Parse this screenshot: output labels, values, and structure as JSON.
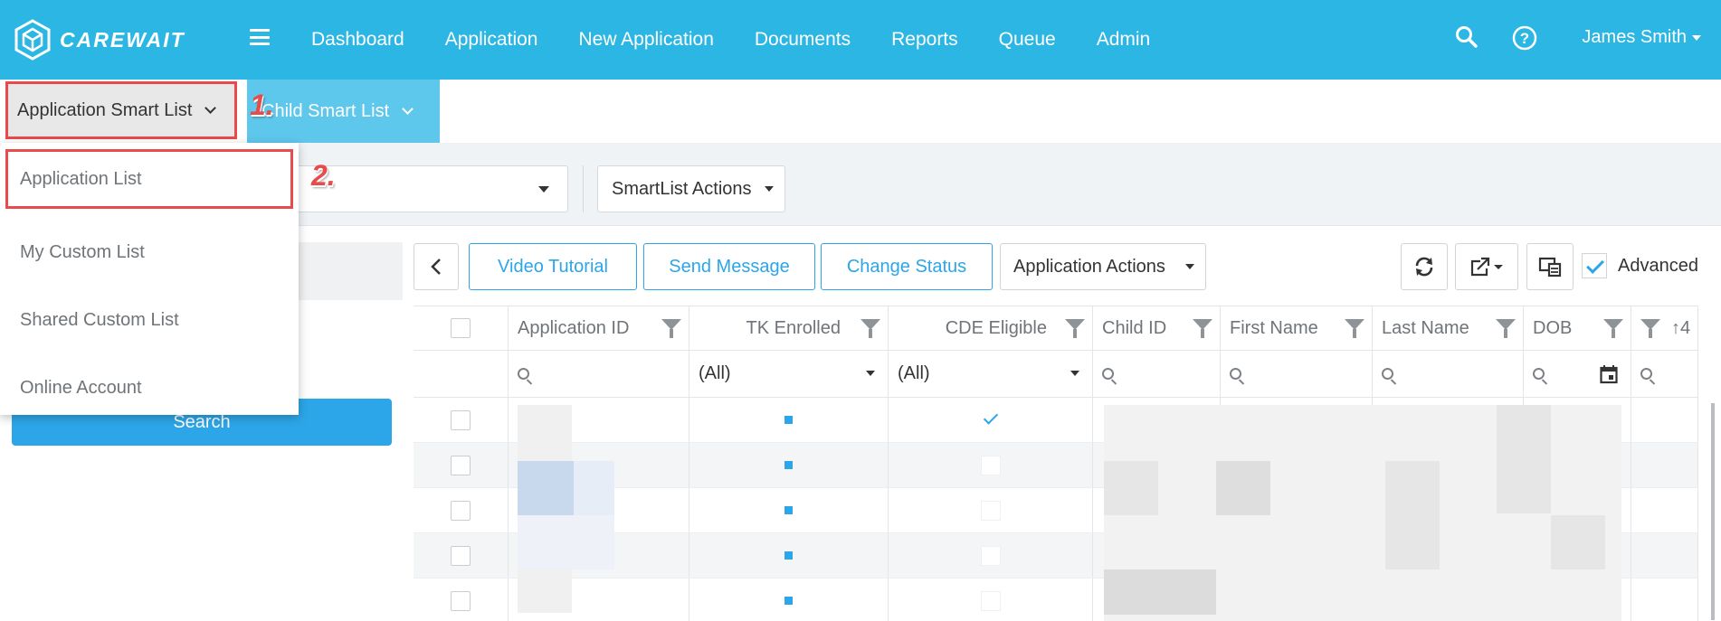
{
  "app": {
    "logo_text": "CAREWAIT"
  },
  "nav": {
    "items": [
      "Dashboard",
      "Application",
      "New Application",
      "Documents",
      "Reports",
      "Queue",
      "Admin"
    ],
    "user": "James Smith"
  },
  "subtabs": {
    "application": "Application Smart List",
    "child": "Child Smart List"
  },
  "annotations": {
    "step1": "1.",
    "step2": "2."
  },
  "dropdown_menu": {
    "items": [
      "Application List",
      "My Custom List",
      "Shared Custom List",
      "Online Account"
    ]
  },
  "filterbar": {
    "smartlist_actions": "SmartList Actions"
  },
  "left_panel": {
    "search_button": "Search"
  },
  "toolbar": {
    "video_tutorial": "Video Tutorial",
    "send_message": "Send Message",
    "change_status": "Change Status",
    "application_actions": "Application Actions",
    "advanced": "Advanced",
    "advanced_checked": true
  },
  "grid": {
    "headers": [
      "Application ID",
      "TK Enrolled",
      "CDE Eligible",
      "Child ID",
      "First Name",
      "Last Name",
      "DOB",
      "↑4"
    ],
    "filters": {
      "tk_enrolled": "(All)",
      "cde_eligible": "(All)"
    },
    "rows": [
      {
        "tk": true,
        "cde": true
      },
      {
        "tk": true,
        "cde": false
      },
      {
        "tk": true,
        "cde": false
      },
      {
        "tk": true,
        "cde": false
      },
      {
        "tk": true,
        "cde": false
      }
    ]
  },
  "colors": {
    "header_bg": "#2cb6e4",
    "accent": "#2ca6e8",
    "annotation": "#e84b4b",
    "child_tab_bg": "#5ec7ec"
  }
}
